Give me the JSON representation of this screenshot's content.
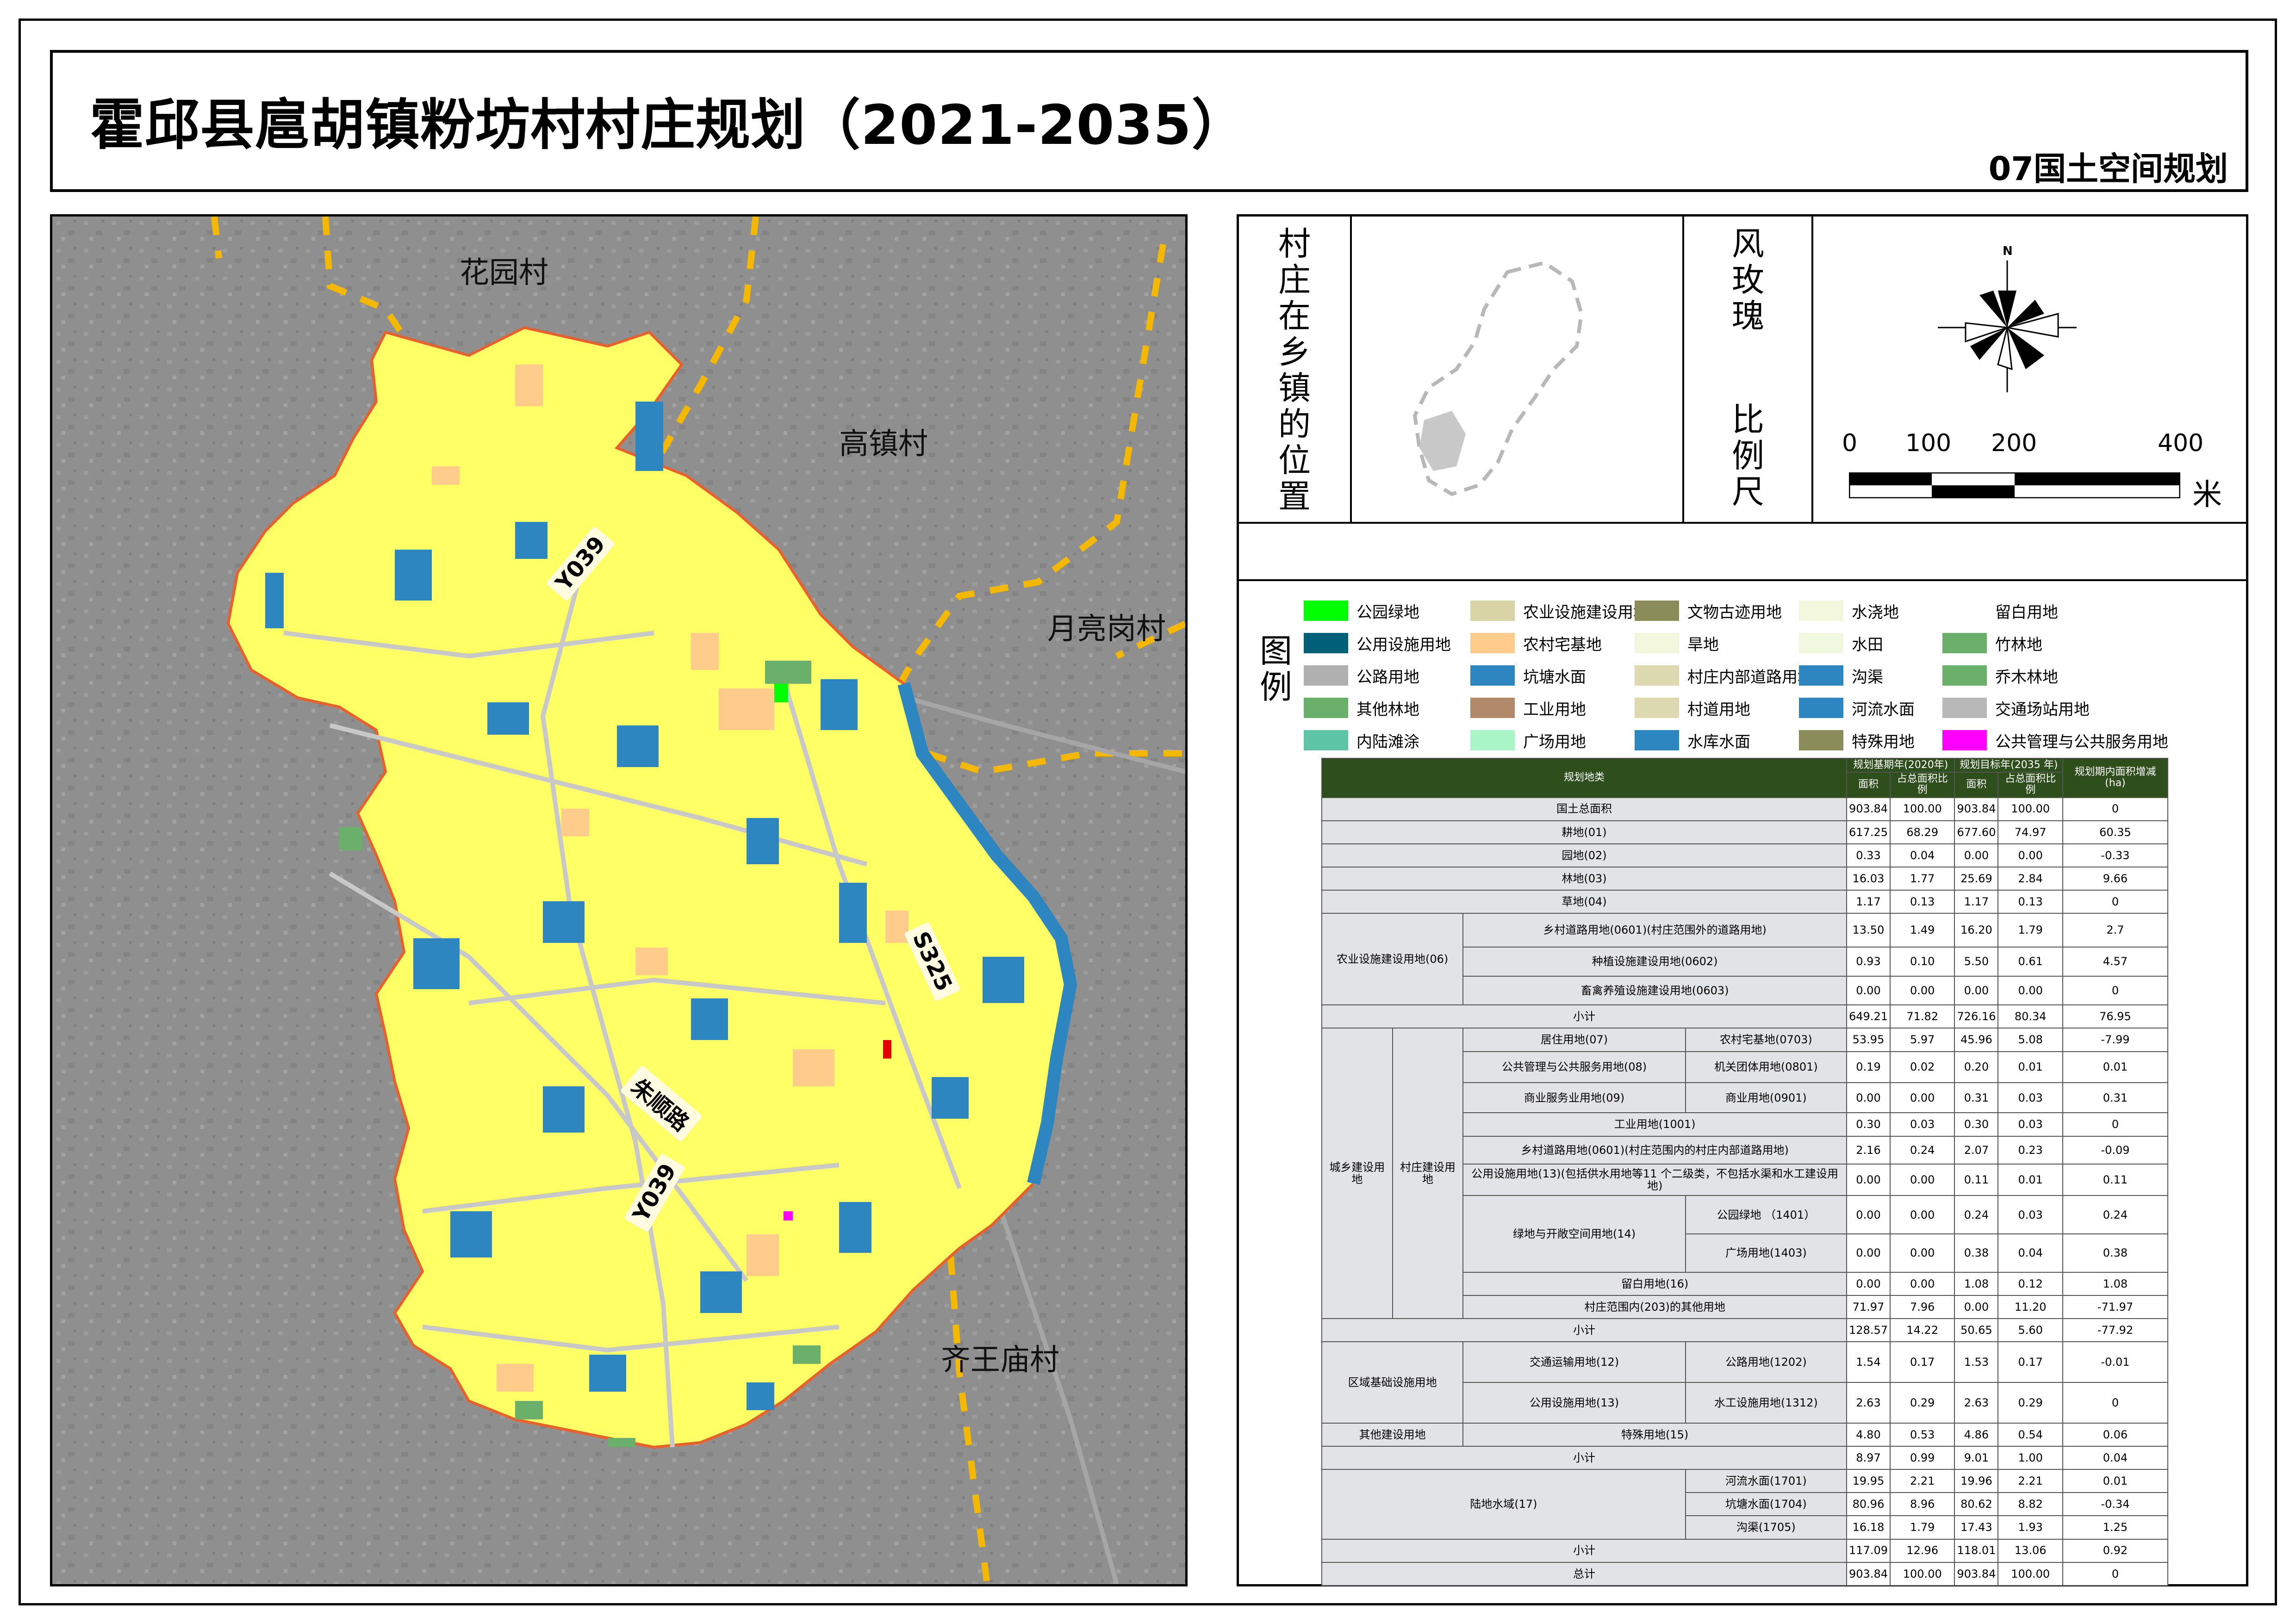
{
  "title": "霍邱县扈胡镇粉坊村村庄规划（2021-2035）",
  "subtitle": "07国土空间规划",
  "map": {
    "villages": {
      "huayuan": "花园村",
      "gaozhen": "高镇村",
      "yueliang": "月亮岗村",
      "qiwang": "齐王庙村"
    },
    "roads": {
      "y039_north": "Y039",
      "y039_south": "Y039",
      "s325": "S325",
      "zhushun": "朱顺路"
    },
    "colors": {
      "cropland": "#ffff66",
      "water": "#2e86c1",
      "homestead": "#ffcc99",
      "boundary": "#e8612c",
      "road": "#bdbdbd",
      "basemap": "#8e8e8e",
      "admin_line": "#f5b800"
    }
  },
  "panel": {
    "location_label": "村庄在乡镇的位置",
    "rose_label": "风玫瑰",
    "scale_label": "比例尺",
    "north": "N",
    "scale": {
      "t0": "0",
      "t1": "100",
      "t2": "200",
      "t3": "400",
      "unit": "米"
    },
    "legend_title": "图例"
  },
  "legend": [
    {
      "label": "公园绿地",
      "color": "#00ff00"
    },
    {
      "label": "农业设施建设用地",
      "color": "#d8d4a6"
    },
    {
      "label": "文物古迹用地",
      "color": "#8a8c5a"
    },
    {
      "label": "水浇地",
      "color": "#f3f7dd"
    },
    {
      "label": "留白用地",
      "color": "#ffffff"
    },
    {
      "label": "公用设施用地",
      "color": "#00607a"
    },
    {
      "label": "农村宅基地",
      "color": "#ffcc8c"
    },
    {
      "label": "旱地",
      "color": "#f3f7dd"
    },
    {
      "label": "水田",
      "color": "#f0f8e0"
    },
    {
      "label": "竹林地",
      "color": "#6ab06a"
    },
    {
      "label": "公路用地",
      "color": "#b0b0b0"
    },
    {
      "label": "坑塘水面",
      "color": "#2e86c1"
    },
    {
      "label": "村庄内部道路用地",
      "color": "#ddd9b0"
    },
    {
      "label": "沟渠",
      "color": "#2e86c1"
    },
    {
      "label": "乔木林地",
      "color": "#6ab06a"
    },
    {
      "label": "其他林地",
      "color": "#6ab06a"
    },
    {
      "label": "工业用地",
      "color": "#b08a6a"
    },
    {
      "label": "村道用地",
      "color": "#ddd9b0"
    },
    {
      "label": "河流水面",
      "color": "#2e86c1"
    },
    {
      "label": "交通场站用地",
      "color": "#b8b8b8"
    },
    {
      "label": "内陆滩涂",
      "color": "#5ec6a6"
    },
    {
      "label": "广场用地",
      "color": "#aaf5c8"
    },
    {
      "label": "水库水面",
      "color": "#2e86c1"
    },
    {
      "label": "特殊用地",
      "color": "#8a8c5a"
    },
    {
      "label": "公共管理与公共服务用地",
      "color": "#ff00ff"
    }
  ],
  "table": {
    "headers": {
      "category": "规划地类",
      "base_year": "规划基期年(2020年)",
      "target_year": "规划目标年(2035 年)",
      "change": "规划期内面积增减(ha)",
      "area": "面积",
      "ratio": "占总面积比例"
    },
    "rows": [
      {
        "a": "国土总面积",
        "v": [
          "903.84",
          "100.00",
          "903.84",
          "100.00",
          "0"
        ]
      },
      {
        "a": "耕地(01)",
        "v": [
          "617.25",
          "68.29",
          "677.60",
          "74.97",
          "60.35"
        ]
      },
      {
        "a": "园地(02)",
        "v": [
          "0.33",
          "0.04",
          "0.00",
          "0.00",
          "-0.33"
        ]
      },
      {
        "a": "林地(03)",
        "v": [
          "16.03",
          "1.77",
          "25.69",
          "2.84",
          "9.66"
        ]
      },
      {
        "a": "草地(04)",
        "v": [
          "1.17",
          "0.13",
          "1.17",
          "0.13",
          "0"
        ]
      },
      {
        "a": "农业设施建设用地(06)",
        "c": "乡村道路用地(0601)(村庄范围外的道路用地)",
        "v": [
          "13.50",
          "1.49",
          "16.20",
          "1.79",
          "2.7"
        ]
      },
      {
        "c": "种植设施建设用地(0602)",
        "v": [
          "0.93",
          "0.10",
          "5.50",
          "0.61",
          "4.57"
        ]
      },
      {
        "c": "畜禽养殖设施建设用地(0603)",
        "v": [
          "0.00",
          "0.00",
          "0.00",
          "0.00",
          "0"
        ]
      },
      {
        "a": "小计",
        "v": [
          "649.21",
          "71.82",
          "726.16",
          "80.34",
          "76.95"
        ]
      },
      {
        "a": "城乡建设用地",
        "b": "村庄建设用地",
        "c": "居住用地(07)",
        "d": "农村宅基地(0703)",
        "v": [
          "53.95",
          "5.97",
          "45.96",
          "5.08",
          "-7.99"
        ]
      },
      {
        "c": "公共管理与公共服务用地(08)",
        "d": "机关团体用地(0801)",
        "v": [
          "0.19",
          "0.02",
          "0.20",
          "0.01",
          "0.01"
        ]
      },
      {
        "c": "商业服务业用地(09)",
        "d": "商业用地(0901)",
        "v": [
          "0.00",
          "0.00",
          "0.31",
          "0.03",
          "0.31"
        ]
      },
      {
        "c": "工业用地(1001)",
        "v": [
          "0.30",
          "0.03",
          "0.30",
          "0.03",
          "0"
        ]
      },
      {
        "c": "乡村道路用地(0601)(村庄范围内的村庄内部道路用地)",
        "v": [
          "2.16",
          "0.24",
          "2.07",
          "0.23",
          "-0.09"
        ]
      },
      {
        "c": "公用设施用地(13)(包括供水用地等11 个二级类，不包括水渠和水工建设用地)",
        "v": [
          "0.00",
          "0.00",
          "0.11",
          "0.01",
          "0.11"
        ]
      },
      {
        "c": "绿地与开敞空间用地(14)",
        "d": "公园绿地 （1401）",
        "v": [
          "0.00",
          "0.00",
          "0.24",
          "0.03",
          "0.24"
        ]
      },
      {
        "d": "广场用地(1403)",
        "v": [
          "0.00",
          "0.00",
          "0.38",
          "0.04",
          "0.38"
        ]
      },
      {
        "c": "留白用地(16)",
        "v": [
          "0.00",
          "0.00",
          "1.08",
          "0.12",
          "1.08"
        ]
      },
      {
        "c": "村庄范围内(203)的其他用地",
        "v": [
          "71.97",
          "7.96",
          "0.00",
          "11.20",
          "-71.97"
        ]
      },
      {
        "a": "小计",
        "v": [
          "128.57",
          "14.22",
          "50.65",
          "5.60",
          "-77.92"
        ]
      },
      {
        "a": "区域基础设施用地",
        "c": "交通运输用地(12)",
        "d": "公路用地(1202)",
        "v": [
          "1.54",
          "0.17",
          "1.53",
          "0.17",
          "-0.01"
        ]
      },
      {
        "c": "公用设施用地(13)",
        "d": "水工设施用地(1312)",
        "v": [
          "2.63",
          "0.29",
          "2.63",
          "0.29",
          "0"
        ]
      },
      {
        "a": "其他建设用地",
        "c": "特殊用地(15)",
        "v": [
          "4.80",
          "0.53",
          "4.86",
          "0.54",
          "0.06"
        ]
      },
      {
        "a": "小计",
        "v": [
          "8.97",
          "0.99",
          "9.01",
          "1.00",
          "0.04"
        ]
      },
      {
        "a": "陆地水域(17)",
        "d": "河流水面(1701)",
        "v": [
          "19.95",
          "2.21",
          "19.96",
          "2.21",
          "0.01"
        ]
      },
      {
        "d": "坑塘水面(1704)",
        "v": [
          "80.96",
          "8.96",
          "80.62",
          "8.82",
          "-0.34"
        ]
      },
      {
        "d": "沟渠(1705)",
        "v": [
          "16.18",
          "1.79",
          "17.43",
          "1.93",
          "1.25"
        ]
      },
      {
        "a": "小计",
        "v": [
          "117.09",
          "12.96",
          "118.01",
          "13.06",
          "0.92"
        ]
      },
      {
        "a": "总计",
        "v": [
          "903.84",
          "100.00",
          "903.84",
          "100.00",
          "0"
        ]
      }
    ]
  }
}
